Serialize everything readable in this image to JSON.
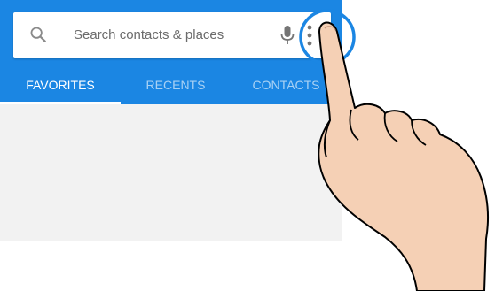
{
  "search": {
    "placeholder": "Search contacts & places",
    "icon": "search-icon",
    "mic_icon": "mic-icon",
    "menu_icon": "more-vert-icon"
  },
  "tabs": [
    {
      "label": "FAVORITES",
      "active": true
    },
    {
      "label": "RECENTS",
      "active": false
    },
    {
      "label": "CONTACTS",
      "active": false
    }
  ],
  "colors": {
    "appbar": "#1b86e3",
    "highlight_ring": "#1b86e3",
    "hand_skin": "#f5d0b5",
    "background": "#f2f2f2"
  }
}
